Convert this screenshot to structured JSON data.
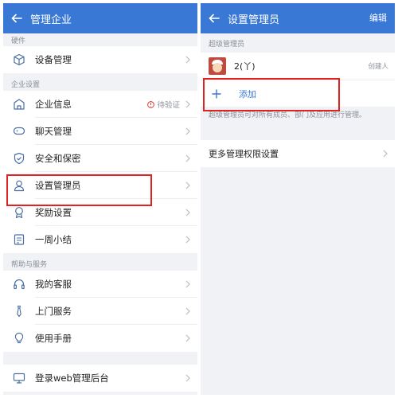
{
  "left": {
    "title": "管理企业",
    "hardware_section": "硬件",
    "hardware_items": [
      {
        "label": "设备管理",
        "icon": "cube-icon"
      }
    ],
    "enterprise_section": "企业设置",
    "enterprise_items": [
      {
        "label": "企业信息",
        "icon": "building-icon",
        "status": "待验证"
      },
      {
        "label": "聊天管理",
        "icon": "chat-bubble-icon"
      },
      {
        "label": "安全和保密",
        "icon": "shield-icon"
      },
      {
        "label": "设置管理员",
        "icon": "person-icon"
      },
      {
        "label": "奖励设置",
        "icon": "medal-icon"
      },
      {
        "label": "一周小结",
        "icon": "report-icon"
      }
    ],
    "help_section": "帮助与服务",
    "help_items": [
      {
        "label": "我的客服",
        "icon": "headset-icon"
      },
      {
        "label": "上门服务",
        "icon": "tie-icon"
      },
      {
        "label": "使用手册",
        "icon": "lightbulb-icon"
      }
    ],
    "web_items": [
      {
        "label": "登录web管理后台",
        "icon": "monitor-icon"
      }
    ]
  },
  "right": {
    "title": "设置管理员",
    "action": "编辑",
    "super_section": "超级管理员",
    "admin_name": "2(丫)",
    "admin_role": "创建人",
    "add_label": "添加",
    "note": "超级管理员可对所有成员、部门及应用进行管理。",
    "more_label": "更多管理权限设置"
  },
  "colors": {
    "accent": "#3a78d6",
    "highlight": "#e0231f",
    "background": "#f1f2f5"
  }
}
